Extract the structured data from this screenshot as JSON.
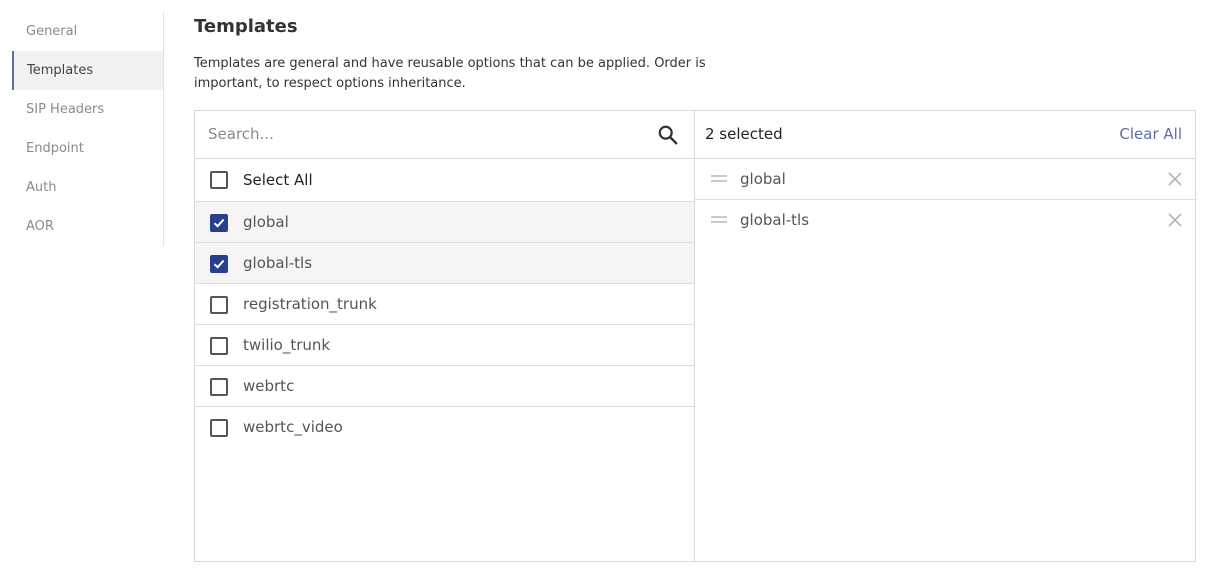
{
  "sidebar": {
    "items": [
      {
        "label": "General"
      },
      {
        "label": "Templates",
        "active": true
      },
      {
        "label": "SIP Headers"
      },
      {
        "label": "Endpoint"
      },
      {
        "label": "Auth"
      },
      {
        "label": "AOR"
      }
    ]
  },
  "header": {
    "title": "Templates",
    "description": "Templates are general and have reusable options that can be applied. Order is important, to respect options inheritance."
  },
  "picker": {
    "search": {
      "placeholder": "Search...",
      "value": "",
      "icon": "search-icon"
    },
    "select_all_label": "Select All",
    "options": [
      {
        "label": "global",
        "checked": true
      },
      {
        "label": "global-tls",
        "checked": true
      },
      {
        "label": "registration_trunk",
        "checked": false
      },
      {
        "label": "twilio_trunk",
        "checked": false
      },
      {
        "label": "webrtc",
        "checked": false
      },
      {
        "label": "webrtc_video",
        "checked": false
      }
    ],
    "selected_count_label": "2 selected",
    "clear_all_label": "Clear All",
    "selected": [
      {
        "label": "global"
      },
      {
        "label": "global-tls"
      }
    ]
  },
  "colors": {
    "accent": "#263f8f",
    "link": "#5b6fa8"
  }
}
